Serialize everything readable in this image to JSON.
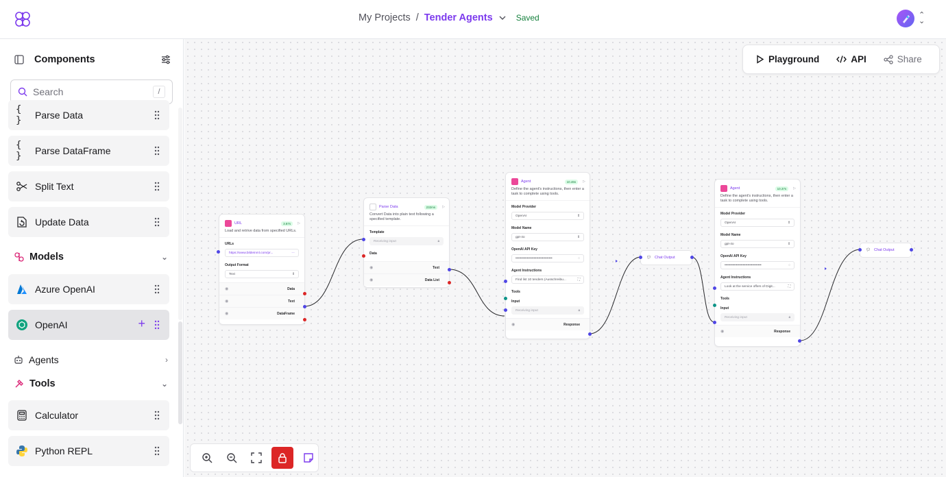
{
  "header": {
    "crumb_root": "My Projects",
    "crumb_sep": "/",
    "project": "Tender Agents",
    "status": "Saved"
  },
  "sidebar": {
    "title": "Components",
    "search_placeholder": "Search",
    "search_shortcut": "/",
    "items_top": [
      {
        "icon": "{ }",
        "label": "Parse Data"
      },
      {
        "icon": "{ }",
        "label": "Parse DataFrame"
      },
      {
        "icon": "scissors-icon",
        "label": "Split Text"
      },
      {
        "icon": "update-icon",
        "label": "Update Data"
      }
    ],
    "models_label": "Models",
    "models": [
      {
        "icon": "azure-icon",
        "label": "Azure OpenAI"
      },
      {
        "icon": "openai-icon",
        "label": "OpenAI"
      }
    ],
    "agents_label": "Agents",
    "tools_label": "Tools",
    "tools": [
      {
        "icon": "calculator-icon",
        "label": "Calculator"
      },
      {
        "icon": "python-icon",
        "label": "Python REPL"
      }
    ]
  },
  "toolbar": {
    "playground": "Playground",
    "api": "API",
    "share": "Share"
  },
  "nodes": {
    "url": {
      "title": "URL",
      "badge": "3.87s",
      "desc": "Load and retrive data from specified URLs.",
      "urls_label": "URLs",
      "urls_value": "https://www.bildeinml.com/pr...",
      "format_label": "Output Format",
      "format_value": "Text",
      "outputs": [
        "Data",
        "Text",
        "DataFrame"
      ]
    },
    "parse": {
      "title": "Parse Data",
      "badge": "232ms",
      "desc": "Convert Data into plain text following a specified template.",
      "template_label": "Template",
      "template_value": "Receiving input",
      "data_label": "Data",
      "outputs": [
        "Text",
        "Data List"
      ]
    },
    "agent1": {
      "title": "Agent",
      "badge": "10.46s",
      "desc": "Define the agent's instructions, then enter a task to complete using tools.",
      "provider_label": "Model Provider",
      "provider_value": "OpenAI",
      "model_label": "Model Name",
      "model_value": "gpt-4o",
      "key_label": "OpenAI API Key",
      "key_value": "••••••••••••••••••••••••••••••••",
      "instr_label": "Agent Instructions",
      "instr_value": "Find list 10 tenders (Ausschreibu...",
      "tools_label": "Tools",
      "input_label": "Input",
      "input_value": "Receiving input",
      "output": "Response"
    },
    "agent2": {
      "title": "Agent",
      "badge": "10.37s",
      "desc": "Define the agent's instructions, then enter a task to complete using tools.",
      "provider_label": "Model Provider",
      "provider_value": "OpenAI",
      "model_label": "Model Name",
      "model_value": "gpt-4o",
      "key_label": "OpenAI API Key",
      "key_value": "••••••••••••••••••••••••••••••••",
      "instr_label": "Agent Instructions",
      "instr_value": "Look at the service offers of Digit...",
      "tools_label": "Tools",
      "input_label": "Input",
      "input_value": "Receiving input",
      "output": "Response"
    },
    "chat1": {
      "title": "Chat Output"
    },
    "chat2": {
      "title": "Chat Output"
    }
  }
}
